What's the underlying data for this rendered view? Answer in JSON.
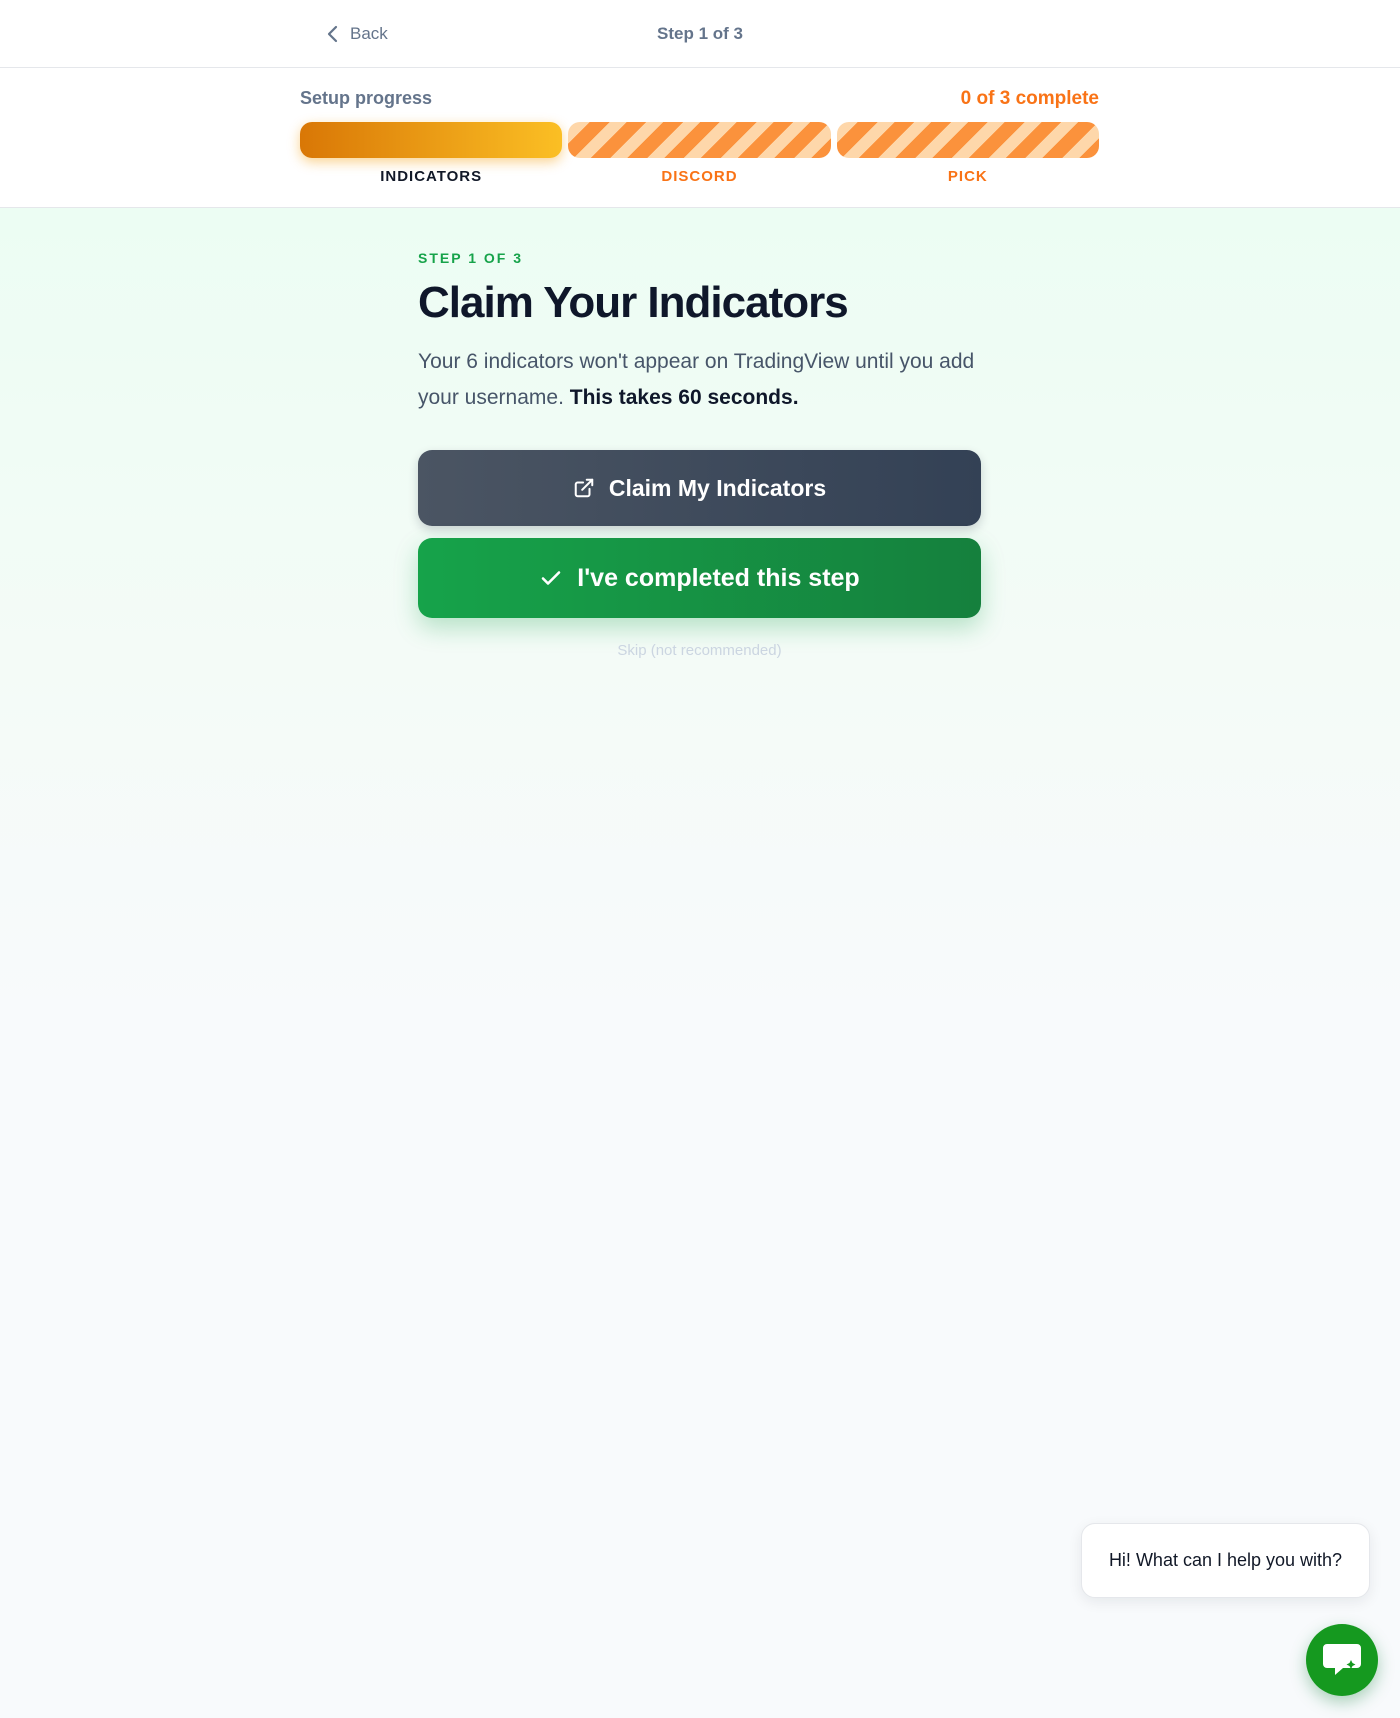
{
  "header": {
    "back_label": "Back",
    "step_indicator": "Step 1 of 3"
  },
  "progress": {
    "label": "Setup progress",
    "count_text": "0 of 3 complete",
    "completed_steps": 0,
    "total_steps": 3,
    "steps": [
      {
        "label": "INDICATORS",
        "state": "active"
      },
      {
        "label": "DISCORD",
        "state": "pending"
      },
      {
        "label": "PICK",
        "state": "pending"
      }
    ],
    "colors": {
      "active_start": "#d97706",
      "active_end": "#fbbf24",
      "pending": "#fb923c"
    }
  },
  "main": {
    "eyebrow": "STEP 1 OF 3",
    "title": "Claim Your Indicators",
    "description_regular": "Your 6 indicators won't appear on TradingView until you add your username. ",
    "description_bold": "This takes 60 seconds.",
    "claim_button_label": "Claim My Indicators",
    "claim_button_icon": "external-link-icon",
    "complete_button_label": "I've completed this step",
    "complete_button_icon": "check-icon",
    "skip_label": "Skip (not recommended)",
    "accent_color": "#16a34a"
  },
  "chat": {
    "bubble_text": "Hi! What can I help you with?",
    "fab_icon": "chat-icon",
    "fab_color": "#15991f"
  }
}
